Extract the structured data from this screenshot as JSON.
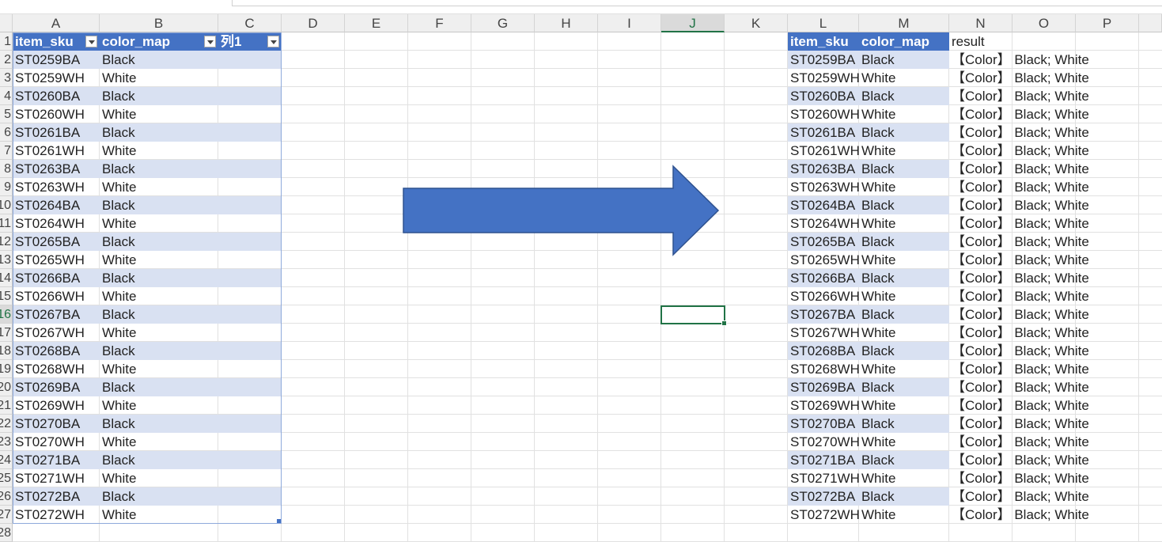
{
  "columns": [
    "A",
    "B",
    "C",
    "D",
    "E",
    "F",
    "G",
    "H",
    "I",
    "J",
    "K",
    "L",
    "M",
    "N",
    "O",
    "P"
  ],
  "active_column": "J",
  "row_numbers": [
    "1",
    "2",
    "3",
    "4",
    "5",
    "6",
    "7",
    "8",
    "9",
    "10",
    "11",
    "12",
    "13",
    "14",
    "15",
    "16",
    "17",
    "18",
    "19",
    "20",
    "21",
    "22",
    "23",
    "24",
    "25",
    "26",
    "27",
    "28"
  ],
  "active_row": "16",
  "left_table": {
    "headers": [
      "item_sku",
      "color_map",
      "列1"
    ],
    "rows": [
      [
        "ST0259BA",
        "Black"
      ],
      [
        "ST0259WH",
        "White"
      ],
      [
        "ST0260BA",
        "Black"
      ],
      [
        "ST0260WH",
        "White"
      ],
      [
        "ST0261BA",
        "Black"
      ],
      [
        "ST0261WH",
        "White"
      ],
      [
        "ST0263BA",
        "Black"
      ],
      [
        "ST0263WH",
        "White"
      ],
      [
        "ST0264BA",
        "Black"
      ],
      [
        "ST0264WH",
        "White"
      ],
      [
        "ST0265BA",
        "Black"
      ],
      [
        "ST0265WH",
        "White"
      ],
      [
        "ST0266BA",
        "Black"
      ],
      [
        "ST0266WH",
        "White"
      ],
      [
        "ST0267BA",
        "Black"
      ],
      [
        "ST0267WH",
        "White"
      ],
      [
        "ST0268BA",
        "Black"
      ],
      [
        "ST0268WH",
        "White"
      ],
      [
        "ST0269BA",
        "Black"
      ],
      [
        "ST0269WH",
        "White"
      ],
      [
        "ST0270BA",
        "Black"
      ],
      [
        "ST0270WH",
        "White"
      ],
      [
        "ST0271BA",
        "Black"
      ],
      [
        "ST0271WH",
        "White"
      ],
      [
        "ST0272BA",
        "Black"
      ],
      [
        "ST0272WH",
        "White"
      ]
    ]
  },
  "right_table": {
    "headers": [
      "item_sku",
      "color_map"
    ],
    "result_header": "result",
    "result_value": "【Color】 Black; White"
  },
  "colors": {
    "table_header": "#4472c4",
    "table_band": "#d9e1f2",
    "arrow_fill": "#4472c4",
    "arrow_stroke": "#2f528f",
    "selection": "#217346"
  }
}
